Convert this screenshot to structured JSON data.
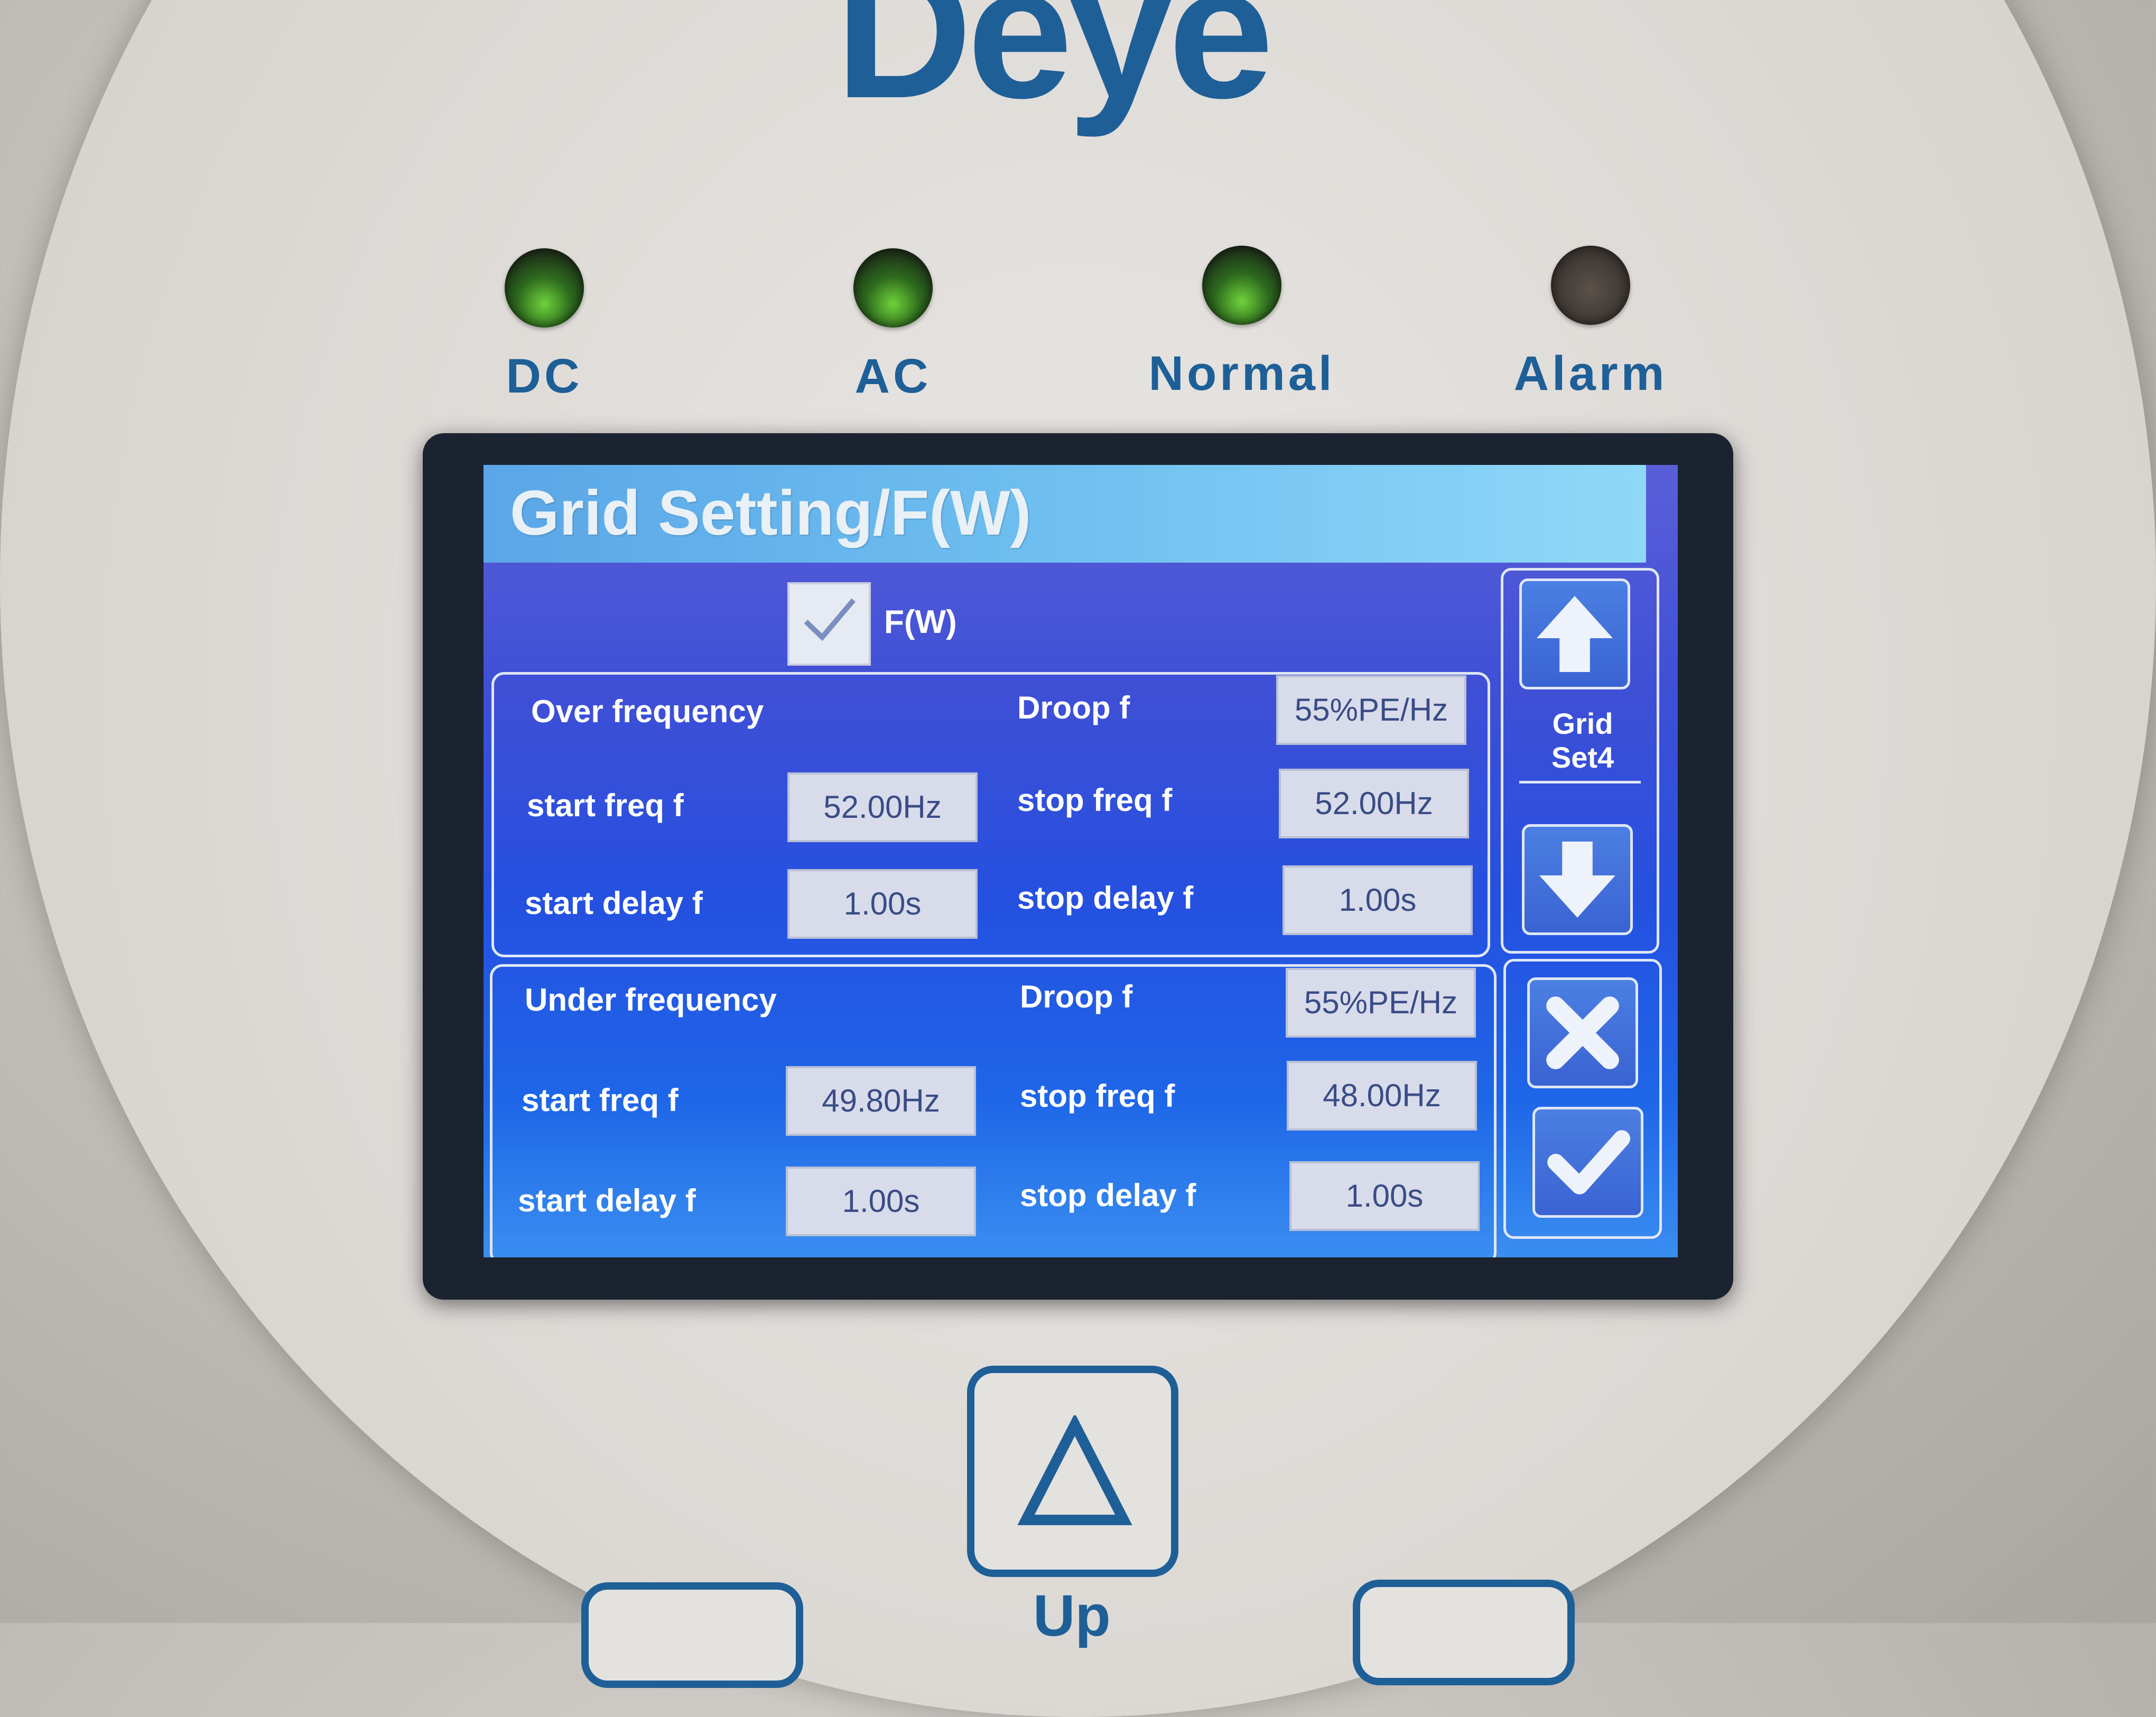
{
  "brand": "Deye",
  "indicators": [
    {
      "label": "DC",
      "state": "on"
    },
    {
      "label": "AC",
      "state": "on"
    },
    {
      "label": "Normal",
      "state": "on"
    },
    {
      "label": "Alarm",
      "state": "off"
    }
  ],
  "screen": {
    "title": "Grid Setting/F(W)",
    "fw_checkbox": {
      "label": "F(W)",
      "checked": true
    },
    "over_frequency": {
      "heading": "Over frequency",
      "droop_label": "Droop f",
      "droop_value": "55%PE/Hz",
      "start_freq_label": "start freq f",
      "start_freq_value": "52.00Hz",
      "stop_freq_label": "stop freq f",
      "stop_freq_value": "52.00Hz",
      "start_delay_label": "start delay f",
      "start_delay_value": "1.00s",
      "stop_delay_label": "stop delay f",
      "stop_delay_value": "1.00s"
    },
    "under_frequency": {
      "heading": "Under frequency",
      "droop_label": "Droop f",
      "droop_value": "55%PE/Hz",
      "start_freq_label": "start freq f",
      "start_freq_value": "49.80Hz",
      "stop_freq_label": "stop freq f",
      "stop_freq_value": "48.00Hz",
      "start_delay_label": "start delay f",
      "start_delay_value": "1.00s",
      "stop_delay_label": "stop delay f",
      "stop_delay_value": "1.00s"
    },
    "page_label_line1": "Grid",
    "page_label_line2": "Set4"
  },
  "hardware": {
    "up_label": "Up"
  },
  "colors": {
    "brand_blue": "#1f5f98",
    "screen_blue": "#2550e0",
    "led_green": "#6fd23a"
  }
}
